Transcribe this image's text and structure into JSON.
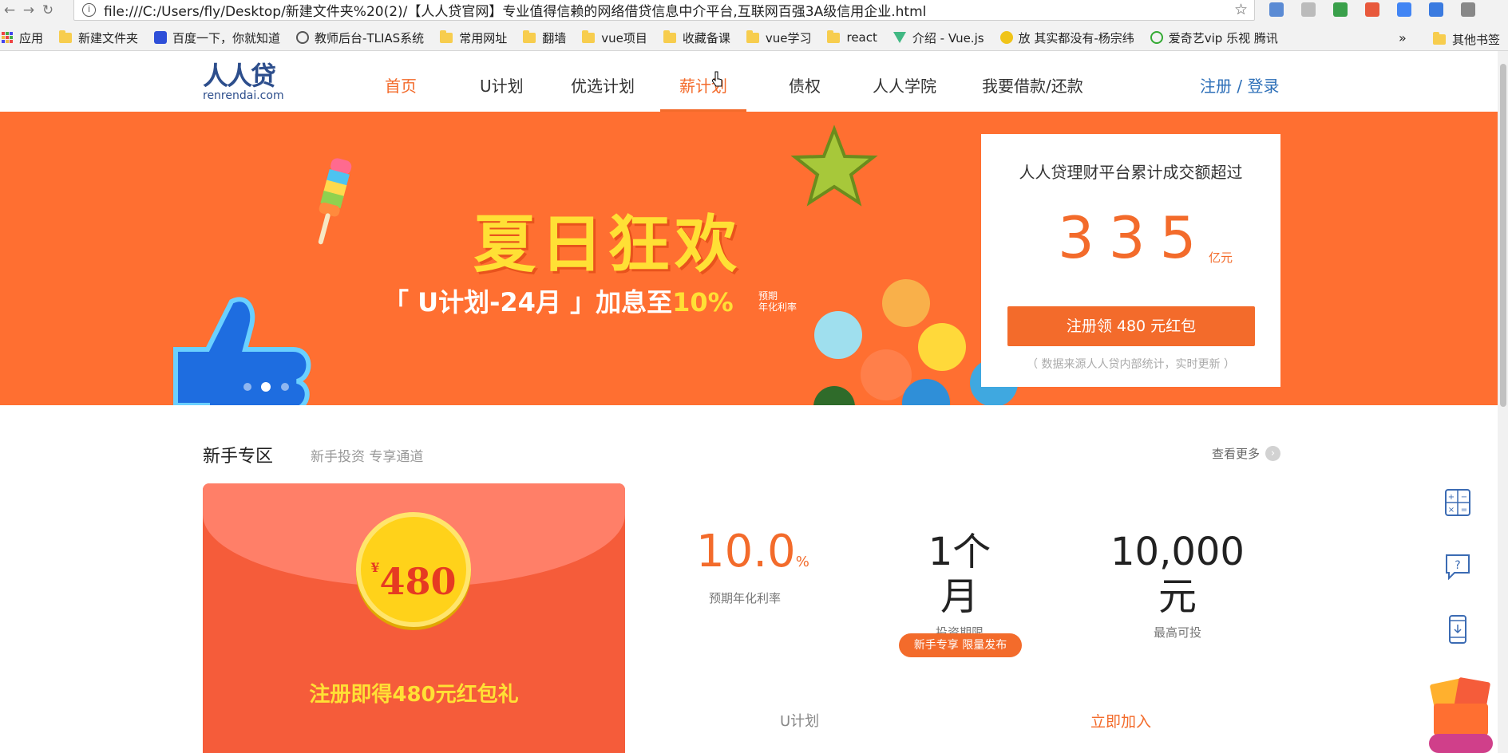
{
  "browser": {
    "url": "file:///C:/Users/fly/Desktop/新建文件夹%20(2)/【人人贷官网】专业值得信赖的网络借贷信息中介平台,互联网百强3A级信用企业.html",
    "bookmarks": [
      {
        "label": "应用",
        "icon": "apps-icon"
      },
      {
        "label": "新建文件夹",
        "icon": "folder-icon"
      },
      {
        "label": "百度一下，你就知道",
        "icon": "baidu-icon"
      },
      {
        "label": "教师后台-TLIAS系统",
        "icon": "globe-icon"
      },
      {
        "label": "常用网址",
        "icon": "folder-icon"
      },
      {
        "label": "翻墙",
        "icon": "folder-icon"
      },
      {
        "label": "vue项目",
        "icon": "folder-icon"
      },
      {
        "label": "收藏备课",
        "icon": "folder-icon"
      },
      {
        "label": "vue学习",
        "icon": "folder-icon"
      },
      {
        "label": "react",
        "icon": "folder-icon"
      },
      {
        "label": "介绍 - Vue.js",
        "icon": "vue-icon"
      },
      {
        "label": "放 其实都没有-杨宗纬",
        "icon": "music-icon"
      },
      {
        "label": "爱奇艺vip 乐视 腾讯",
        "icon": "iqiyi-icon"
      }
    ],
    "bookmarks_overflow": "»",
    "other_bookmarks": "其他书签"
  },
  "header": {
    "logo_mark": "人人贷",
    "logo_text": "renrendai.com",
    "nav": [
      "首页",
      "U计划",
      "优选计划",
      "薪计划",
      "债权",
      "人人学院",
      "我要借款/还款"
    ],
    "active_nav": "首页",
    "login": "注册 / 登录"
  },
  "banner": {
    "title": "夏日狂欢",
    "subtitle_pre": "「 U计划-24月 」加息至",
    "subtitle_rate": "10%",
    "rate_label_line1": "预期",
    "rate_label_line2": "年化利率"
  },
  "stats": {
    "title": "人人贷理财平台累计成交额超过",
    "amount": "335",
    "unit": "亿元",
    "register_button": "注册领 480 元红包",
    "note": "（ 数据来源人人贷内部统计，实时更新 ）"
  },
  "newbie": {
    "title": "新手专区",
    "subtitle": "新手投资 专享通道",
    "more": "查看更多",
    "envelope_coin": "480",
    "envelope_currency": "¥",
    "envelope_text": "注册即得480元红包礼",
    "rate_value": "10.0",
    "rate_unit": "%",
    "rate_label": "预期年化利率",
    "term_value": "1个月",
    "term_label": "投资期限",
    "max_value": "10,000元",
    "max_label": "最高可投",
    "badge": "新手专享 限量发布",
    "plan_name": "U计划",
    "join": "立即加入"
  },
  "colors": {
    "brand_orange": "#f36b2b",
    "brand_blue": "#2d4e8c",
    "banner_bg": "#ff6f31",
    "highlight_yellow": "#ffe035"
  }
}
